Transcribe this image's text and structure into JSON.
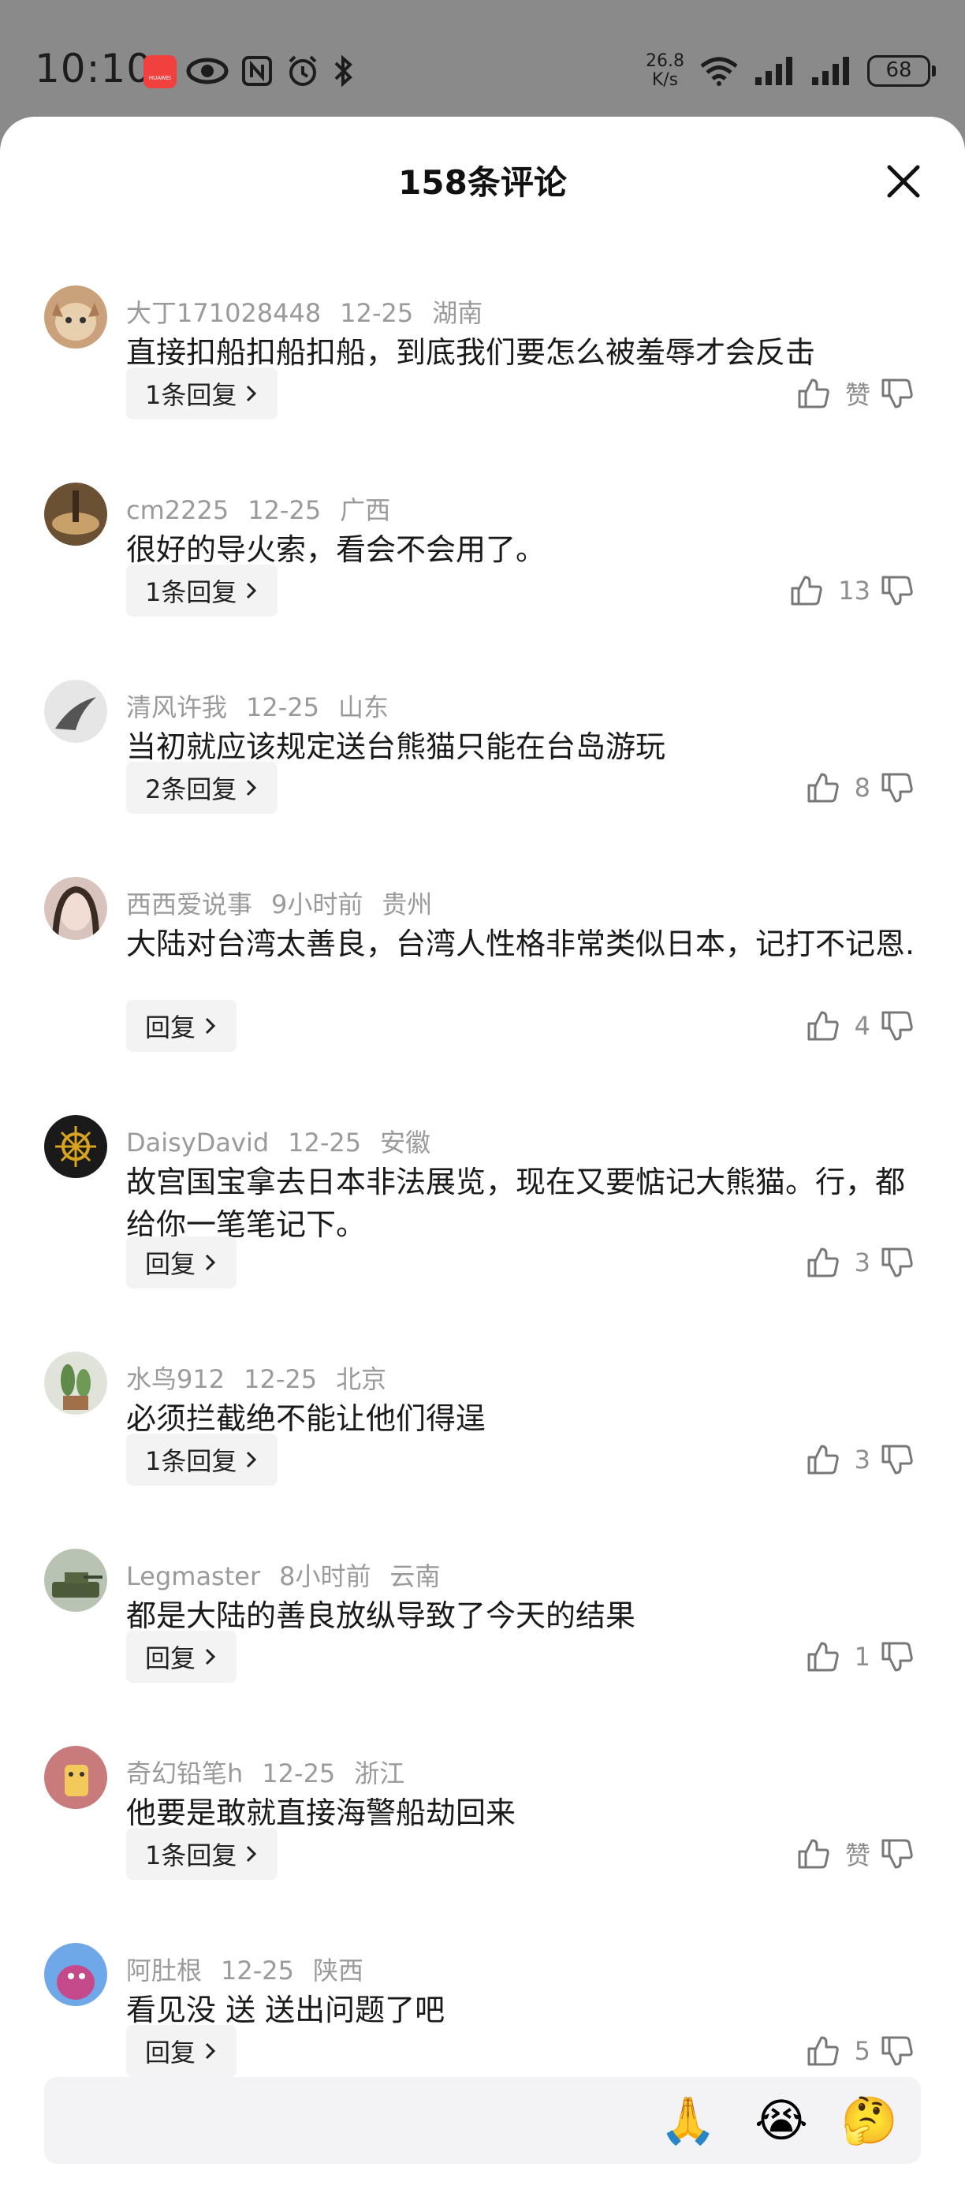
{
  "status_bar": {
    "time": "10:10",
    "app_badge": "HUAWEI",
    "net_speed_value": "26.8",
    "net_speed_unit": "K/s",
    "battery": "68",
    "icons_left": [
      "eye-icon",
      "nfc-icon",
      "alarm-icon",
      "bluetooth-icon"
    ],
    "icons_right": [
      "wifi-icon",
      "signal-icon",
      "signal-icon",
      "battery-icon"
    ]
  },
  "header": {
    "title": "158条评论"
  },
  "comments": [
    {
      "user": "大丁171028448",
      "date": "12-25",
      "region": "湖南",
      "text": "直接扣船扣船扣船，到底我们要怎么被羞辱才会反击",
      "reply_label": "1条回复",
      "likes": "赞"
    },
    {
      "user": "cm2225",
      "date": "12-25",
      "region": "广西",
      "text": "很好的导火索，看会不会用了。",
      "reply_label": "1条回复",
      "likes": "13"
    },
    {
      "user": "清风许我",
      "date": "12-25",
      "region": "山东",
      "text": "当初就应该规定送台熊猫只能在台岛游玩",
      "reply_label": "2条回复",
      "likes": "8"
    },
    {
      "user": "西西爱说事",
      "date": "9小时前",
      "region": "贵州",
      "text": "大陆对台湾太善良，台湾人性格非常类似日本，记打不记恩.",
      "reply_label": "回复",
      "likes": "4"
    },
    {
      "user": "DaisyDavid",
      "date": "12-25",
      "region": "安徽",
      "text": "故宫国宝拿去日本非法展览，现在又要惦记大熊猫。行，都给你一笔笔记下。",
      "reply_label": "回复",
      "likes": "3"
    },
    {
      "user": "水鸟912",
      "date": "12-25",
      "region": "北京",
      "text": "必须拦截绝不能让他们得逞",
      "reply_label": "1条回复",
      "likes": "3"
    },
    {
      "user": "Legmaster",
      "date": "8小时前",
      "region": "云南",
      "text": "都是大陆的善良放纵导致了今天的结果",
      "reply_label": "回复",
      "likes": "1"
    },
    {
      "user": "奇幻铅笔h",
      "date": "12-25",
      "region": "浙江",
      "text": "他要是敢就直接海警船劫回来",
      "reply_label": "1条回复",
      "likes": "赞"
    },
    {
      "user": "阿肚根",
      "date": "12-25",
      "region": "陕西",
      "text": "看见没 送 送出问题了吧",
      "reply_label": "回复",
      "likes": "5"
    }
  ],
  "input_bar": {
    "placeholder": "",
    "emojis": [
      {
        "name": "folded-hands-emoji",
        "glyph": "🙏"
      },
      {
        "name": "crying-face-emoji",
        "glyph": "😭"
      },
      {
        "name": "thinking-face-emoji",
        "glyph": "🤔"
      }
    ]
  },
  "colors": {
    "overlay": "#8a8a8a",
    "sheet": "#ffffff",
    "meta_text": "#9a9a9a",
    "reply_bg": "#f3f3f3"
  }
}
